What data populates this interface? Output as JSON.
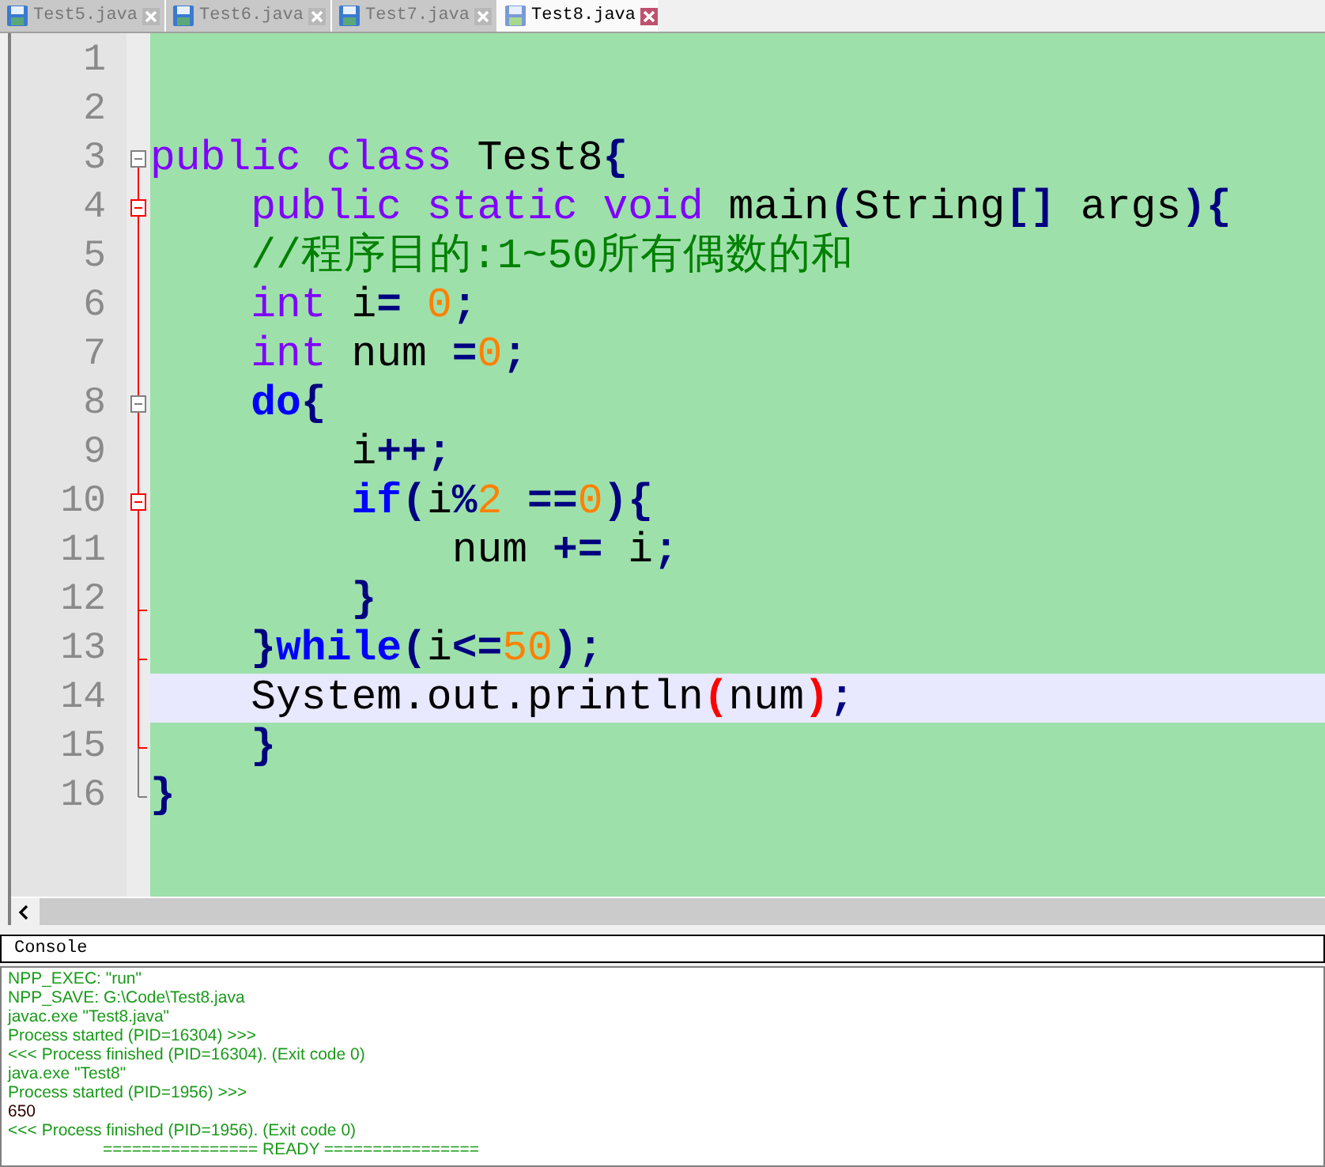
{
  "tabs": [
    {
      "label": "Test5.java",
      "selected": false
    },
    {
      "label": "Test6.java",
      "selected": false
    },
    {
      "label": "Test7.java",
      "selected": false
    },
    {
      "label": "Test8.java",
      "selected": true
    }
  ],
  "editor": {
    "lines": [
      {
        "number": "1",
        "current": false
      },
      {
        "number": "2",
        "current": false
      },
      {
        "number": "3",
        "current": false,
        "fold_marker": {
          "kind": "box",
          "active": false
        },
        "tokens": [
          {
            "kind": "keyword",
            "text": "public class"
          },
          {
            "kind": "plain",
            "text": " Test8"
          },
          {
            "kind": "operator",
            "text": "{"
          }
        ]
      },
      {
        "number": "4",
        "current": false,
        "fold_marker": {
          "kind": "box",
          "active": true
        },
        "tokens": [
          {
            "kind": "keyword",
            "text": "    public static void"
          },
          {
            "kind": "plain",
            "text": " main"
          },
          {
            "kind": "operator",
            "text": "("
          },
          {
            "kind": "plain",
            "text": "String"
          },
          {
            "kind": "operator",
            "text": "[]"
          },
          {
            "kind": "plain",
            "text": " args"
          },
          {
            "kind": "operator",
            "text": "){"
          }
        ]
      },
      {
        "number": "5",
        "current": false,
        "fold_marker": {
          "kind": "line",
          "active": true
        },
        "tokens": [
          {
            "kind": "comment",
            "text": "    //程序目的:1~50所有偶数的和"
          }
        ]
      },
      {
        "number": "6",
        "current": false,
        "fold_marker": {
          "kind": "line",
          "active": true
        },
        "tokens": [
          {
            "kind": "keyword",
            "text": "    int"
          },
          {
            "kind": "plain",
            "text": " i"
          },
          {
            "kind": "operator",
            "text": "="
          },
          {
            "kind": "number",
            "text": " 0"
          },
          {
            "kind": "operator",
            "text": ";"
          }
        ]
      },
      {
        "number": "7",
        "current": false,
        "fold_marker": {
          "kind": "line",
          "active": true
        },
        "tokens": [
          {
            "kind": "keyword",
            "text": "    int"
          },
          {
            "kind": "plain",
            "text": " num "
          },
          {
            "kind": "operator",
            "text": "="
          },
          {
            "kind": "number",
            "text": "0"
          },
          {
            "kind": "operator",
            "text": ";"
          }
        ]
      },
      {
        "number": "8",
        "current": false,
        "fold_marker": {
          "kind": "box",
          "active": false
        },
        "tokens": [
          {
            "kind": "instruction",
            "text": "    do"
          },
          {
            "kind": "operator",
            "text": "{"
          }
        ]
      },
      {
        "number": "9",
        "current": false,
        "fold_marker": {
          "kind": "line",
          "active": true
        },
        "tokens": [
          {
            "kind": "plain",
            "text": "        i"
          },
          {
            "kind": "operator",
            "text": "++;"
          }
        ]
      },
      {
        "number": "10",
        "current": false,
        "fold_marker": {
          "kind": "box",
          "active": true
        },
        "tokens": [
          {
            "kind": "instruction",
            "text": "        if"
          },
          {
            "kind": "operator",
            "text": "("
          },
          {
            "kind": "plain",
            "text": "i"
          },
          {
            "kind": "operator",
            "text": "%"
          },
          {
            "kind": "number",
            "text": "2"
          },
          {
            "kind": "operator",
            "text": " =="
          },
          {
            "kind": "number",
            "text": "0"
          },
          {
            "kind": "operator",
            "text": "){"
          }
        ]
      },
      {
        "number": "11",
        "current": false,
        "fold_marker": {
          "kind": "line",
          "active": true
        },
        "tokens": [
          {
            "kind": "plain",
            "text": "            num "
          },
          {
            "kind": "operator",
            "text": "+="
          },
          {
            "kind": "plain",
            "text": " i"
          },
          {
            "kind": "operator",
            "text": ";"
          }
        ]
      },
      {
        "number": "12",
        "current": false,
        "fold_marker": {
          "kind": "tick",
          "active": true
        },
        "tokens": [
          {
            "kind": "operator",
            "text": "        }"
          }
        ]
      },
      {
        "number": "13",
        "current": false,
        "fold_marker": {
          "kind": "tick",
          "active": true
        },
        "tokens": [
          {
            "kind": "operator",
            "text": "    }"
          },
          {
            "kind": "instruction",
            "text": "while"
          },
          {
            "kind": "operator",
            "text": "("
          },
          {
            "kind": "plain",
            "text": "i"
          },
          {
            "kind": "operator",
            "text": "<="
          },
          {
            "kind": "number",
            "text": "50"
          },
          {
            "kind": "operator",
            "text": ");"
          }
        ]
      },
      {
        "number": "14",
        "current": true,
        "fold_marker": {
          "kind": "line",
          "active": true
        },
        "tokens": [
          {
            "kind": "plain",
            "text": "    System.out.println"
          },
          {
            "kind": "brace",
            "text": "("
          },
          {
            "kind": "plain",
            "text": "num"
          },
          {
            "kind": "brace",
            "text": ")"
          },
          {
            "kind": "operator",
            "text": ";"
          }
        ]
      },
      {
        "number": "15",
        "current": false,
        "fold_marker": {
          "kind": "end",
          "active": true
        },
        "tokens": [
          {
            "kind": "operator",
            "text": "    }"
          }
        ]
      },
      {
        "number": "16",
        "current": false,
        "fold_marker": {
          "kind": "end",
          "active": false
        },
        "tokens": [
          {
            "kind": "operator",
            "text": "}"
          }
        ]
      }
    ]
  },
  "console": {
    "title": "Console",
    "lines": [
      {
        "kind": "info",
        "text": "NPP_EXEC: \"run\""
      },
      {
        "kind": "info",
        "text": "NPP_SAVE: G:\\Code\\Test8.java"
      },
      {
        "kind": "info",
        "text": "javac.exe \"Test8.java\""
      },
      {
        "kind": "info",
        "text": "Process started (PID=16304) >>>"
      },
      {
        "kind": "info",
        "text": "<<< Process finished (PID=16304). (Exit code 0)"
      },
      {
        "kind": "info",
        "text": "java.exe \"Test8\""
      },
      {
        "kind": "info",
        "text": "Process started (PID=1956) >>>"
      },
      {
        "kind": "output",
        "text": "650"
      },
      {
        "kind": "info",
        "text": "<<< Process finished (PID=1956). (Exit code 0)"
      },
      {
        "kind": "status",
        "text": "================ READY ================"
      }
    ]
  }
}
